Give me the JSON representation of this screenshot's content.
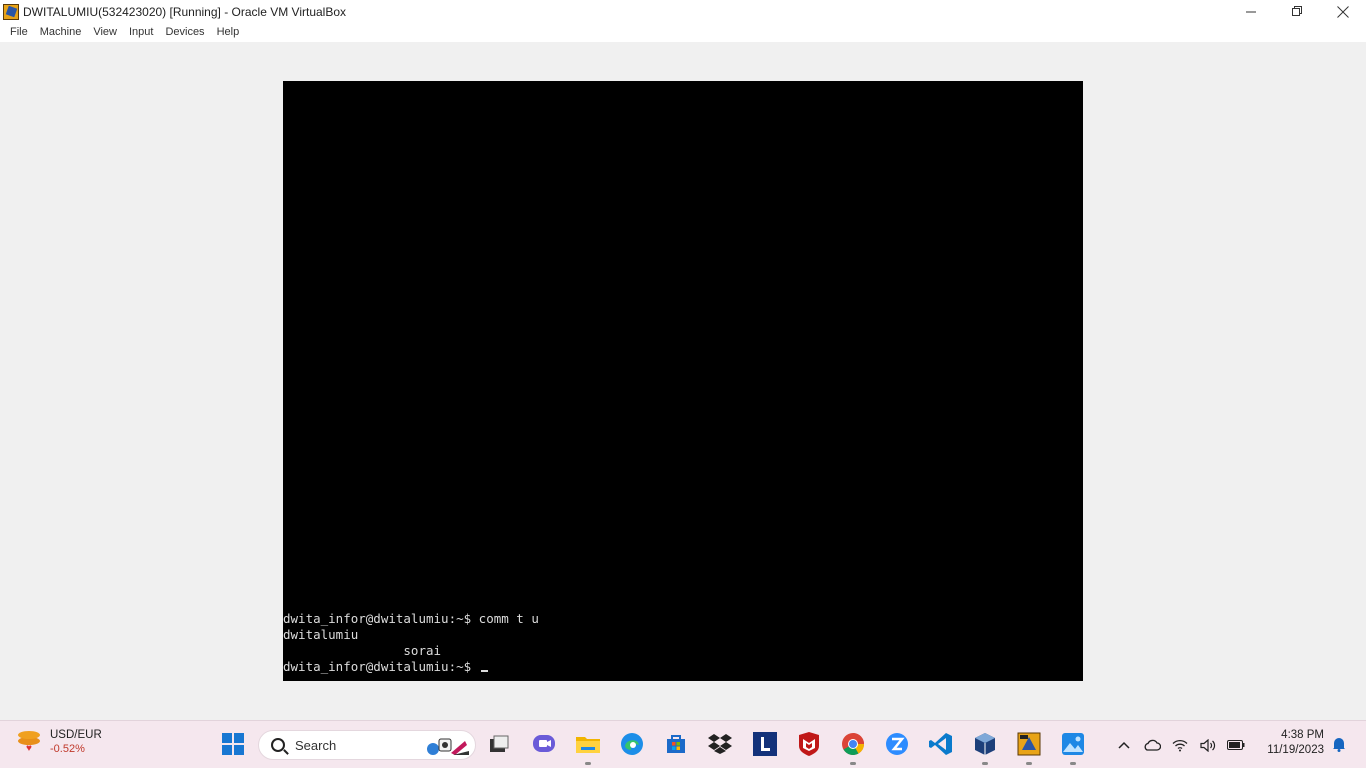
{
  "window": {
    "title": "DWITALUMIU(532423020) [Running] - Oracle VM VirtualBox",
    "controls": {
      "minimize": "—",
      "restore": "❐",
      "close": "✕"
    }
  },
  "menubar": {
    "items": [
      "File",
      "Machine",
      "View",
      "Input",
      "Devices",
      "Help"
    ]
  },
  "terminal": {
    "lines": [
      "dwita_infor@dwitalumiu:~$ comm t u",
      "dwitalumiu",
      "                sorai",
      "dwita_infor@dwitalumiu:~$ "
    ]
  },
  "taskbar": {
    "widget": {
      "title": "USD/EUR",
      "change": "-0.52%"
    },
    "search_label": "Search",
    "icons": [
      "windows-start-icon",
      "file-explorer-task-view-icon",
      "teams-chat-icon",
      "file-explorer-icon",
      "edge-browser-icon",
      "microsoft-store-icon",
      "dropbox-icon",
      "l-app-icon",
      "mcafee-icon",
      "chrome-icon",
      "zoom-icon",
      "vscode-icon",
      "virtualbox-icon",
      "virtualbox-vm-icon",
      "photos-icon"
    ],
    "tray": {
      "chevron": "^"
    },
    "clock": {
      "time": "4:38 PM",
      "date": "11/19/2023"
    }
  },
  "colors": {
    "accent": "#1877d2",
    "terminal_bg": "#000000",
    "terminal_fg": "#dcdcdc",
    "taskbar_bg": "#f5e7ee",
    "negative": "#c0392b"
  }
}
